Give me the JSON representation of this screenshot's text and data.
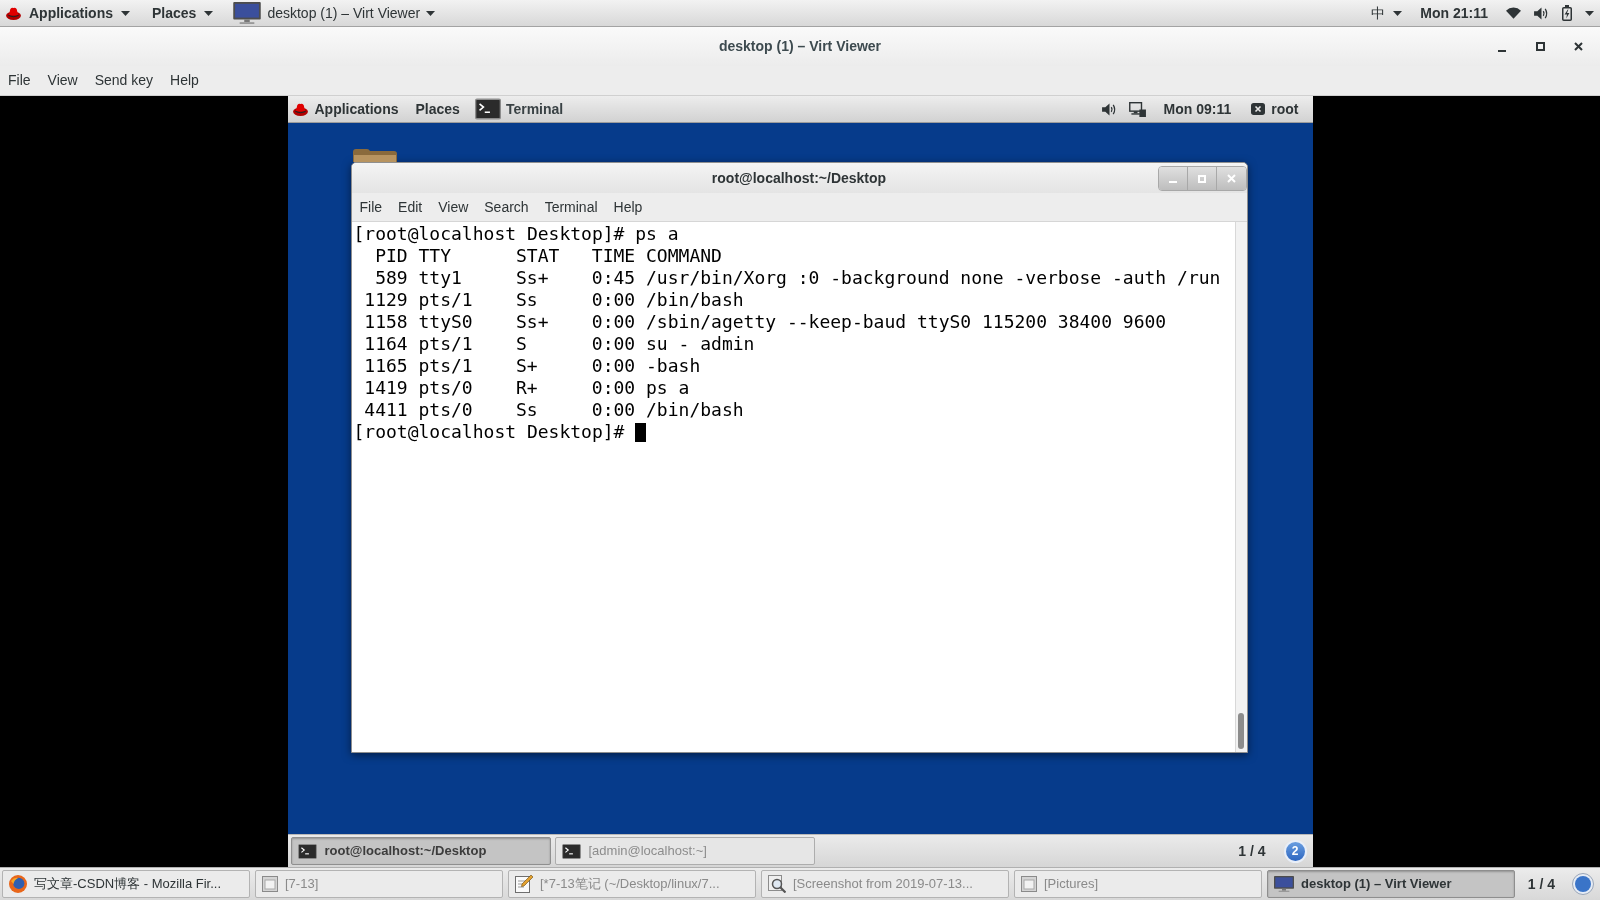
{
  "host_top_bar": {
    "applications": "Applications",
    "places": "Places",
    "window_menu": "desktop (1) – Virt Viewer",
    "input_method": "中",
    "clock": "Mon 21:11"
  },
  "viewer_window": {
    "title": "desktop (1) – Virt Viewer",
    "menu": [
      "File",
      "View",
      "Send key",
      "Help"
    ]
  },
  "guest": {
    "top_bar": {
      "applications": "Applications",
      "places": "Places",
      "app": "Terminal",
      "clock": "Mon 09:11",
      "user": "root"
    },
    "terminal": {
      "title": "root@localhost:~/Desktop",
      "menu": [
        "File",
        "Edit",
        "View",
        "Search",
        "Terminal",
        "Help"
      ],
      "command_line": "[root@localhost Desktop]# ps a",
      "ps_table": {
        "columns": [
          "PID",
          "TTY",
          "STAT",
          "TIME",
          "COMMAND"
        ],
        "rows": [
          [
            "589",
            "tty1",
            "Ss+",
            "0:45",
            "/usr/bin/Xorg :0 -background none -verbose -auth /run"
          ],
          [
            "1129",
            "pts/1",
            "Ss",
            "0:00",
            "/bin/bash"
          ],
          [
            "1158",
            "ttyS0",
            "Ss+",
            "0:00",
            "/sbin/agetty --keep-baud ttyS0 115200 38400 9600"
          ],
          [
            "1164",
            "pts/1",
            "S",
            "0:00",
            "su - admin"
          ],
          [
            "1165",
            "pts/1",
            "S+",
            "0:00",
            "-bash"
          ],
          [
            "1419",
            "pts/0",
            "R+",
            "0:00",
            "ps a"
          ],
          [
            "4411",
            "pts/0",
            "Ss",
            "0:00",
            "/bin/bash"
          ]
        ]
      },
      "prompt": "[root@localhost Desktop]#",
      "cursor": true
    },
    "taskbar": {
      "items": [
        {
          "label": "root@localhost:~/Desktop",
          "selected": true,
          "minimized": false
        },
        {
          "label": "[admin@localhost:~]",
          "selected": false,
          "minimized": true
        }
      ],
      "workspace": "1 / 4",
      "workspace_button": "2"
    }
  },
  "host_taskbar": {
    "items": [
      {
        "kind": "browser",
        "label": "写文章-CSDN博客 - Mozilla Fir...",
        "selected": false,
        "minimized": false
      },
      {
        "kind": "window",
        "label": "[7-13]",
        "selected": false,
        "minimized": true
      },
      {
        "kind": "editor",
        "label": "[*7-13笔记 (~/Desktop/linux/7...",
        "selected": false,
        "minimized": true
      },
      {
        "kind": "screenshot",
        "label": "[Screenshot from 2019-07-13...",
        "selected": false,
        "minimized": true
      },
      {
        "kind": "window",
        "label": "[Pictures]",
        "selected": false,
        "minimized": true
      },
      {
        "kind": "viewer",
        "label": "desktop (1) – Virt Viewer",
        "selected": true,
        "minimized": false
      }
    ],
    "workspace": "1 / 4"
  }
}
